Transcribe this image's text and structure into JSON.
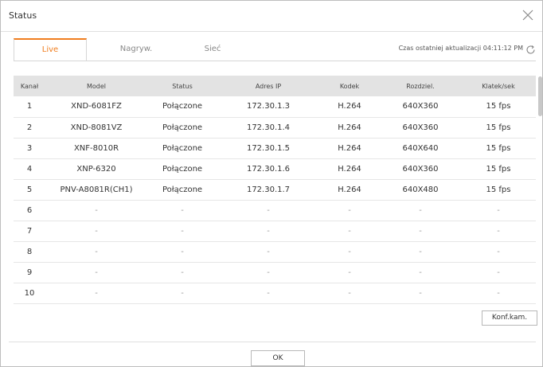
{
  "dialog": {
    "title": "Status"
  },
  "tabs": [
    {
      "label": "Live",
      "active": true
    },
    {
      "label": "Nagryw.",
      "active": false
    },
    {
      "label": "Sieć",
      "active": false
    }
  ],
  "last_update": "Czas ostatniej aktualizacji 04:11:12 PM",
  "table": {
    "headers": [
      "Kanał",
      "Model",
      "Status",
      "Adres IP",
      "Kodek",
      "Rozdziel.",
      "Klatek/sek"
    ],
    "rows": [
      [
        "1",
        "XND-6081FZ",
        "Połączone",
        "172.30.1.3",
        "H.264",
        "640X360",
        "15 fps"
      ],
      [
        "2",
        "XND-8081VZ",
        "Połączone",
        "172.30.1.4",
        "H.264",
        "640X360",
        "15 fps"
      ],
      [
        "3",
        "XNF-8010R",
        "Połączone",
        "172.30.1.5",
        "H.264",
        "640X640",
        "15 fps"
      ],
      [
        "4",
        "XNP-6320",
        "Połączone",
        "172.30.1.6",
        "H.264",
        "640X360",
        "15 fps"
      ],
      [
        "5",
        "PNV-A8081R(CH1)",
        "Połączone",
        "172.30.1.7",
        "H.264",
        "640X480",
        "15 fps"
      ],
      [
        "6",
        "-",
        "-",
        "-",
        "-",
        "-",
        "-"
      ],
      [
        "7",
        "-",
        "-",
        "-",
        "-",
        "-",
        "-"
      ],
      [
        "8",
        "-",
        "-",
        "-",
        "-",
        "-",
        "-"
      ],
      [
        "9",
        "-",
        "-",
        "-",
        "-",
        "-",
        "-"
      ],
      [
        "10",
        "-",
        "-",
        "-",
        "-",
        "-",
        "-"
      ]
    ]
  },
  "buttons": {
    "camera_config": "Konf.kam.",
    "ok": "OK"
  },
  "icons": {
    "close": "close-icon",
    "refresh": "refresh-icon"
  },
  "colors": {
    "accent": "#f07d1e",
    "header_bg": "#e3e3e3"
  }
}
